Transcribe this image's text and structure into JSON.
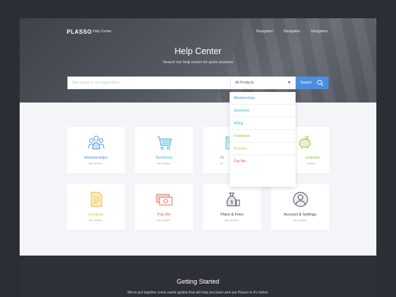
{
  "header": {
    "logo": "PLASSO",
    "help_center_link": "Help Center",
    "nav": [
      "Navigation",
      "Navigation",
      "Navigation"
    ]
  },
  "hero": {
    "title": "Help Center",
    "subtitle": "Search our help center for quick answers"
  },
  "search": {
    "placeholder": "Start typing to see suggestions",
    "select_value": "All Products",
    "button_label": "Search"
  },
  "dropdown": {
    "options": [
      {
        "label": "Memberships",
        "color": "#4a8fe3"
      },
      {
        "label": "Storefront",
        "color": "#3ab0d8"
      },
      {
        "label": "Billing",
        "color": "#36c3b4"
      },
      {
        "label": "Fundraise",
        "color": "#8fc43a"
      },
      {
        "label": "Invoices",
        "color": "#f0b232"
      },
      {
        "label": "Pay Me",
        "color": "#e8624d"
      }
    ]
  },
  "cards": [
    {
      "label": "Memberships",
      "sub": "See articles",
      "color": "#4a8fe3",
      "icon": "people-icon"
    },
    {
      "label": "Storefront",
      "sub": "See articles",
      "color": "#3ab0d8",
      "icon": "storefront-icon"
    },
    {
      "label": "Bi",
      "sub": "Se",
      "color": "#36c3b4",
      "icon": "billing-icon"
    },
    {
      "label": "undraise",
      "sub": "articles",
      "color": "#8fc43a",
      "icon": "piggy-bank-icon"
    },
    {
      "label": "Invoices",
      "sub": "See articles",
      "color": "#f0b232",
      "icon": "invoice-icon"
    },
    {
      "label": "Pay Me",
      "sub": "See articles",
      "color": "#e8624d",
      "icon": "money-icon"
    },
    {
      "label": "Plans & Fees",
      "sub": "See articles",
      "color": "#3a3f47",
      "icon": "money-bag-icon"
    },
    {
      "label": "Account & Settings",
      "sub": "See articles",
      "color": "#3a3f47",
      "icon": "account-icon"
    }
  ],
  "footer": {
    "title": "Getting Started",
    "subtitle": "We've put together some useful guides that will help you learn and use Plasso to it's fullest."
  }
}
